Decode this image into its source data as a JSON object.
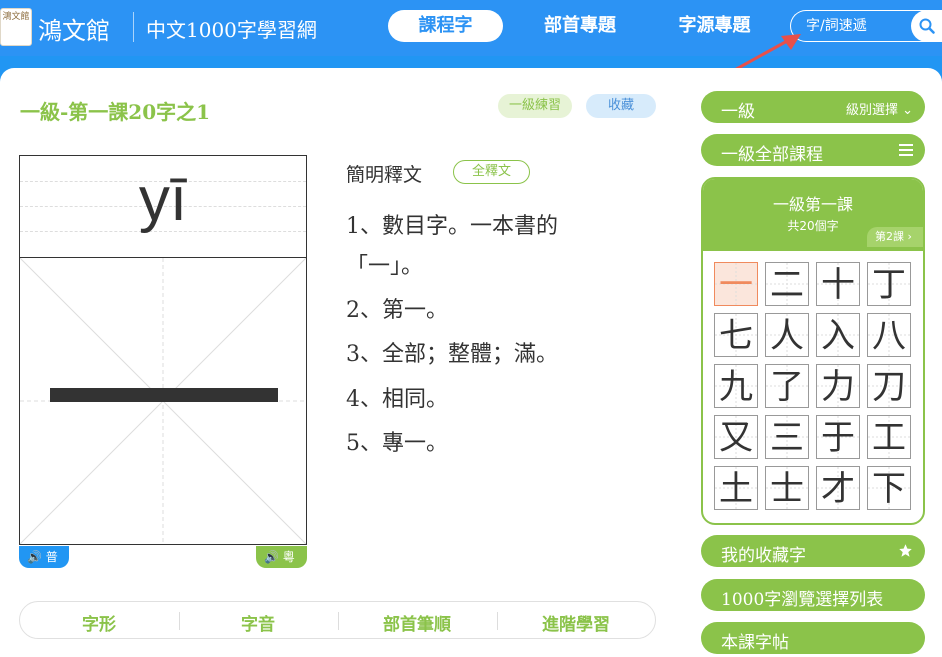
{
  "header": {
    "brand": "鴻文館",
    "logo_text": "鴻文館",
    "subtitle": "中文1000字學習網",
    "nav": [
      "課程字",
      "部首專題",
      "字源專題"
    ],
    "active_nav": "課程字",
    "search_placeholder": "字/詞速遞",
    "colors": {
      "header_bg": "#2c93f4",
      "accent_green": "#8bc34a"
    }
  },
  "main": {
    "title": "一級-第一課20字之1",
    "practice_label": "一級練習",
    "favorite_label": "收藏",
    "pinyin": "yī",
    "character": "一",
    "audio_putonghua": "普",
    "audio_cantonese": "粵",
    "definition_heading": "簡明釋文",
    "full_text_button": "全釋文",
    "definitions": [
      "1、數目字。一本書的",
      "「一」。",
      "2、第一。",
      "3、全部；整體；滿。",
      "4、相同。",
      "5、專一。"
    ],
    "tabs": [
      "字形",
      "字音",
      "部首筆順",
      "進階學習"
    ]
  },
  "sidebar": {
    "level_label": "一級",
    "level_select": "級別選擇",
    "all_lessons": "一級全部課程",
    "lesson_title": "一級第一課",
    "lesson_count": "共20個字",
    "next_lesson": "第2課",
    "characters": [
      "一",
      "二",
      "十",
      "丁",
      "七",
      "人",
      "入",
      "八",
      "九",
      "了",
      "力",
      "刀",
      "又",
      "三",
      "于",
      "工",
      "土",
      "士",
      "才",
      "下"
    ],
    "selected_character": "一",
    "favorites": "我的收藏字",
    "browse_list": "1000字瀏覽選擇列表",
    "copybook": "本課字帖"
  }
}
